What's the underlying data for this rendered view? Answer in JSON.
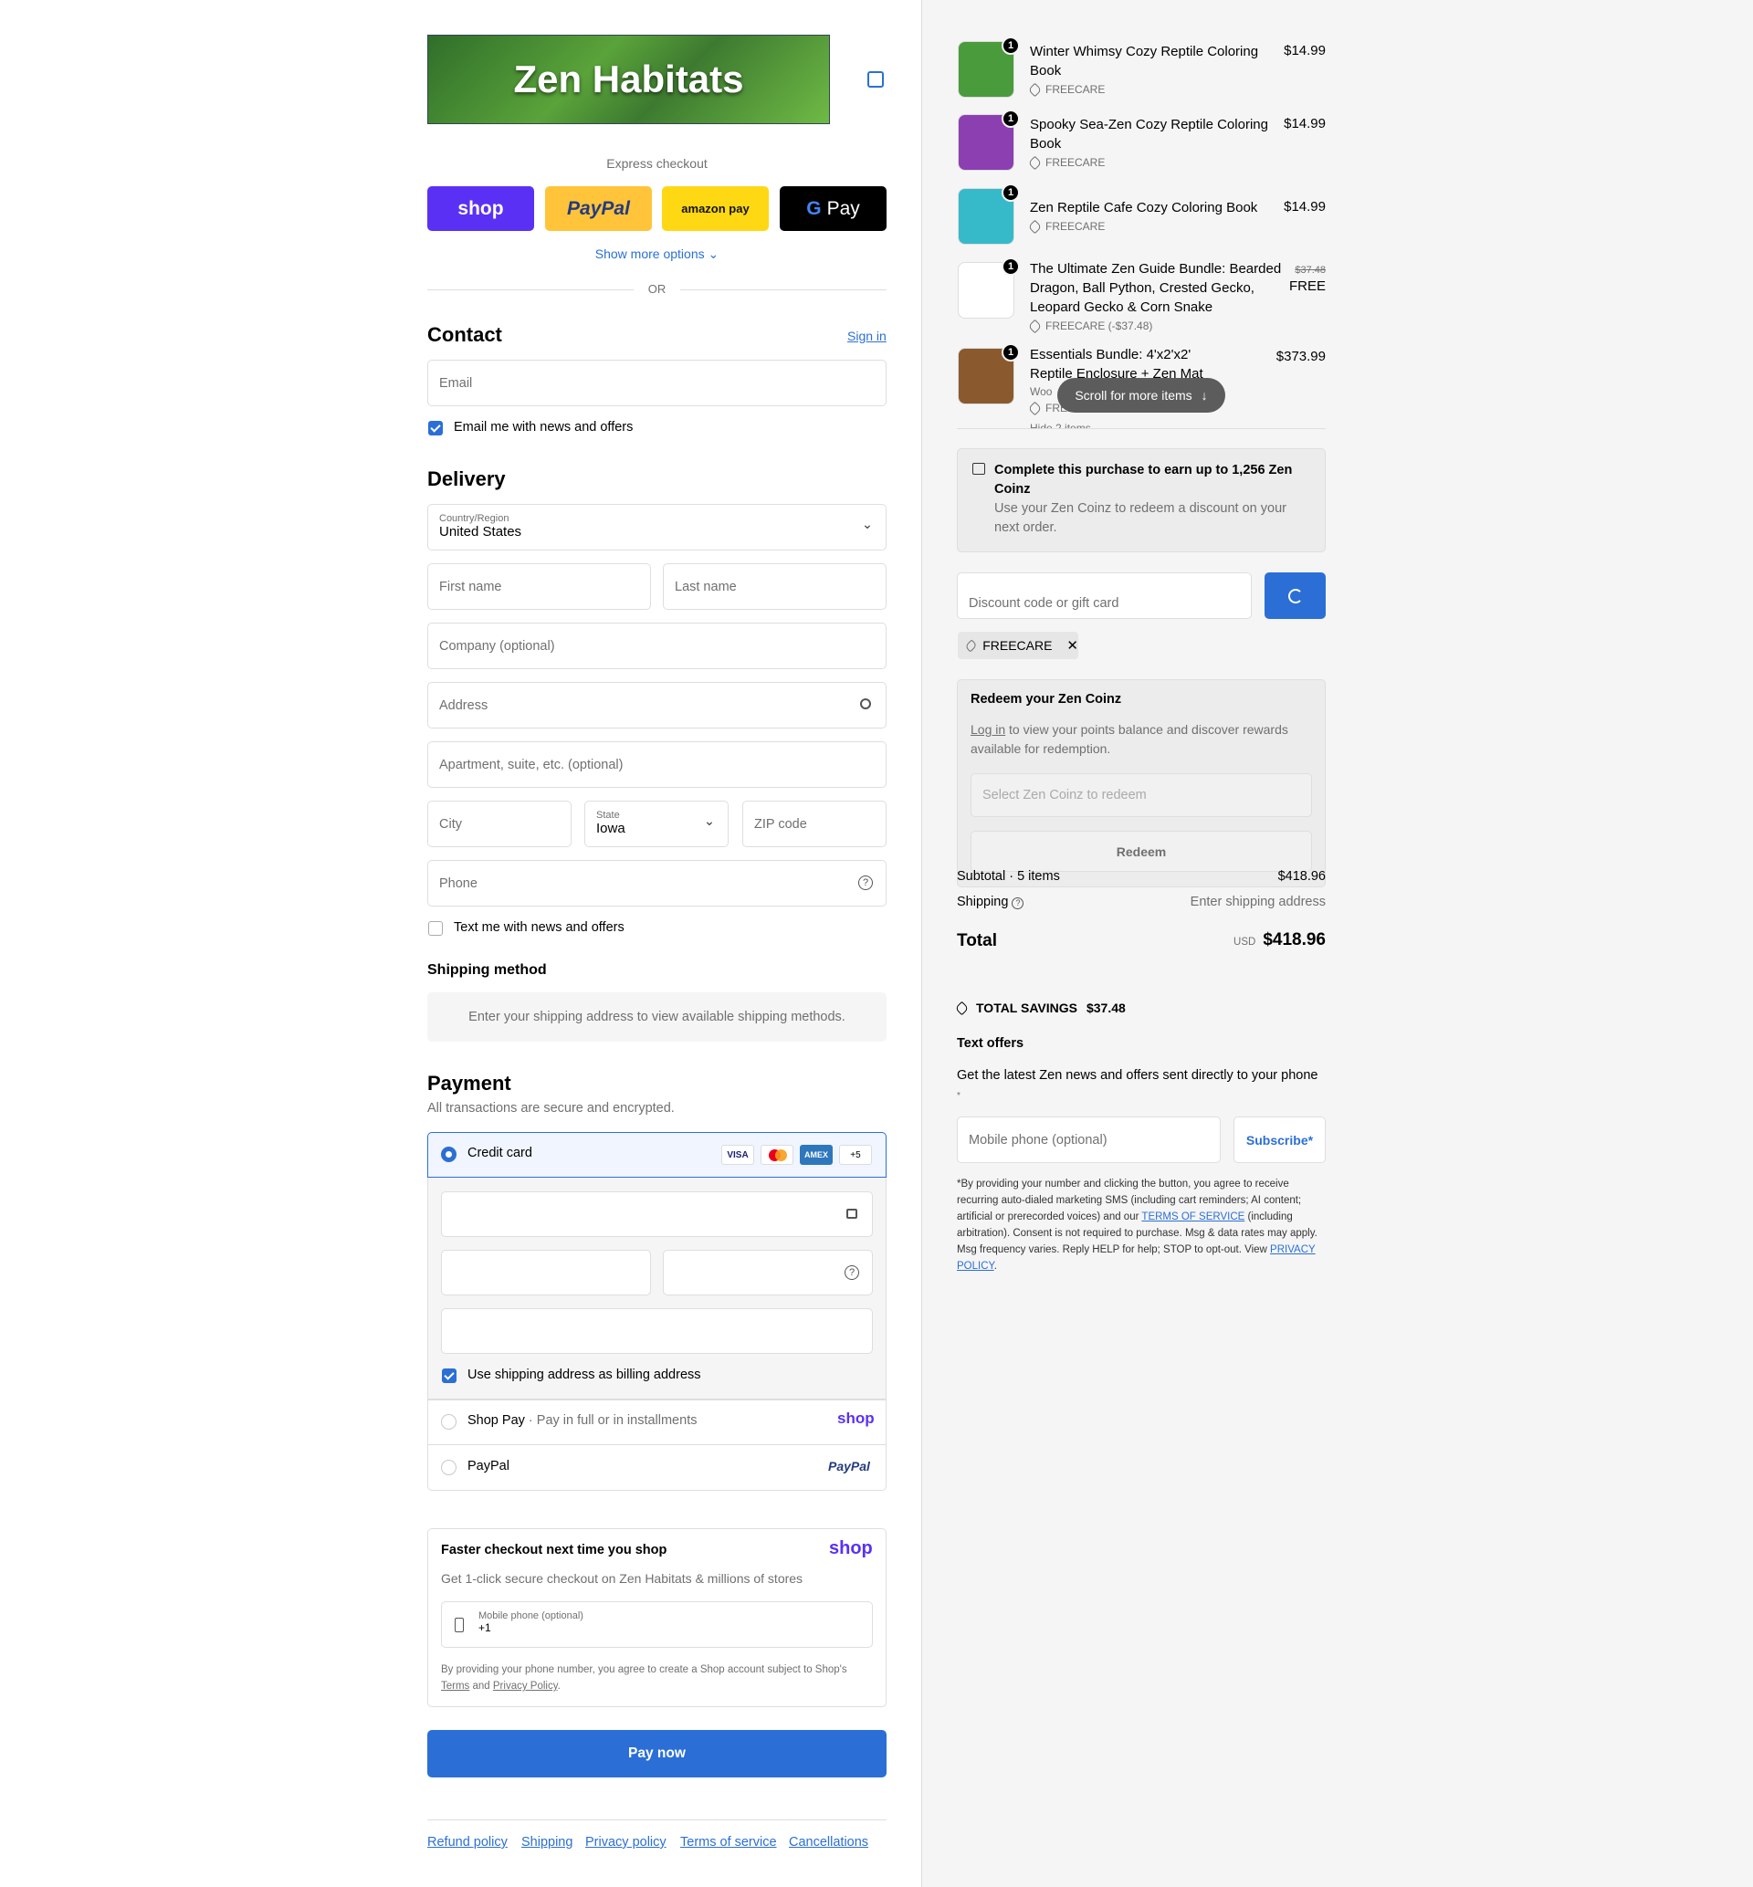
{
  "brand": {
    "name": "Zen Habitats"
  },
  "express": {
    "label": "Express checkout",
    "shop": "shop",
    "paypal": "PayPal",
    "amazon": "amazon pay",
    "gpay": "Pay",
    "more": "Show more options",
    "or": "OR"
  },
  "contact": {
    "title": "Contact",
    "signin": "Sign in",
    "email_placeholder": "Email",
    "news_label": "Email me with news and offers"
  },
  "delivery": {
    "title": "Delivery",
    "country_label": "Country/Region",
    "country": "United States",
    "first": "First name",
    "last": "Last name",
    "company": "Company (optional)",
    "address": "Address",
    "apt": "Apartment, suite, etc. (optional)",
    "city": "City",
    "state_label": "State",
    "state": "Iowa",
    "zip": "ZIP code",
    "phone": "Phone",
    "text_label": "Text me with news and offers"
  },
  "shipping_method": {
    "title": "Shipping method",
    "notice": "Enter your shipping address to view available shipping methods."
  },
  "payment": {
    "title": "Payment",
    "subtitle": "All transactions are secure and encrypted.",
    "credit_card": "Credit card",
    "cards": [
      "VISA",
      "MC",
      "AMEX",
      "+5"
    ],
    "billing_label": "Use shipping address as billing address",
    "shoppay": "Shop Pay",
    "shoppay_sub": "Pay in full or in installments",
    "shoppay_logo": "shop",
    "paypal": "PayPal",
    "paypal_logo": "PayPal"
  },
  "faster": {
    "title": "Faster checkout next time you shop",
    "logo": "shop",
    "desc": "Get 1-click secure checkout on Zen Habitats & millions of stores",
    "phone_label": "Mobile phone (optional)",
    "phone_prefix": "+1",
    "legal_a": "By providing your phone number, you agree to create a Shop account subject to Shop's ",
    "terms": "Terms",
    "and": " and ",
    "privacy": "Privacy Policy",
    "dot": "."
  },
  "pay_now": "Pay now",
  "footer": [
    "Refund policy",
    "Shipping",
    "Privacy policy",
    "Terms of service",
    "Cancellations"
  ],
  "cart": {
    "items": [
      {
        "name": "Winter Whimsy Cozy Reptile Coloring Book",
        "price": "$14.99",
        "tag": "FREECARE",
        "qty": "1",
        "color": "#4a9b3c"
      },
      {
        "name": "Spooky Sea-Zen Cozy Reptile Coloring Book",
        "price": "$14.99",
        "tag": "FREECARE",
        "qty": "1",
        "color": "#8c3fb0"
      },
      {
        "name": "Zen Reptile Cafe Cozy Coloring Book",
        "price": "$14.99",
        "tag": "FREECARE",
        "qty": "1",
        "color": "#36b9c9"
      },
      {
        "name": "The Ultimate Zen Guide Bundle: Bearded Dragon, Ball Python, Crested Gecko, Leopard Gecko & Corn Snake",
        "old_price": "$37.48",
        "price": "FREE",
        "tag": "FREECARE (-$37.48)",
        "qty": "1",
        "color": "#ffffff"
      },
      {
        "name": "Essentials Bundle: 4'x2'x2' Reptile Enclosure + Zen Mat",
        "price": "$373.99",
        "sub": "Woo",
        "tag": "FREECARE",
        "qty": "1",
        "color": "#8a5a2e",
        "hide": "Hide 2 items"
      }
    ],
    "scroll_hint": "Scroll for more items"
  },
  "coinz": {
    "title": "Complete this purchase to earn up to 1,256 Zen Coinz",
    "desc": "Use your Zen Coinz to redeem a discount on your next order."
  },
  "discount": {
    "placeholder": "Discount code or gift card",
    "applied": "FREECARE"
  },
  "redeem": {
    "title": "Redeem your Zen Coinz",
    "login": "Log in",
    "desc": " to view your points balance and discover rewards available for redemption.",
    "select": "Select Zen Coinz to redeem",
    "button": "Redeem"
  },
  "summary": {
    "subtotal_label": "Subtotal · 5 items",
    "subtotal": "$418.96",
    "shipping_label": "Shipping",
    "shipping": "Enter shipping address",
    "total_label": "Total",
    "currency": "USD",
    "total": "$418.96",
    "savings_label": "TOTAL SAVINGS",
    "savings": "$37.48"
  },
  "text_offers": {
    "title": "Text offers",
    "desc": "Get the latest Zen news and offers sent directly to your phone",
    "star": "*",
    "phone_placeholder": "Mobile phone (optional)",
    "subscribe": "Subscribe*",
    "legal_a": "*By providing your number and clicking the button, you agree to receive recurring auto-dialed marketing SMS (including cart reminders; AI content; artificial or prerecorded voices) and our ",
    "tos": "TERMS OF SERVICE",
    "legal_b": " (including arbitration). Consent is not required to purchase. Msg & data rates may apply. Msg frequency varies. Reply HELP for help; STOP to opt-out. View ",
    "privacy": "PRIVACY POLICY",
    "end": "."
  },
  "colors": {
    "accent": "#2b6fd6",
    "shop_purple": "#5a31f4",
    "paypal_yellow": "#ffc439",
    "amazon_yellow": "#ffd814"
  }
}
